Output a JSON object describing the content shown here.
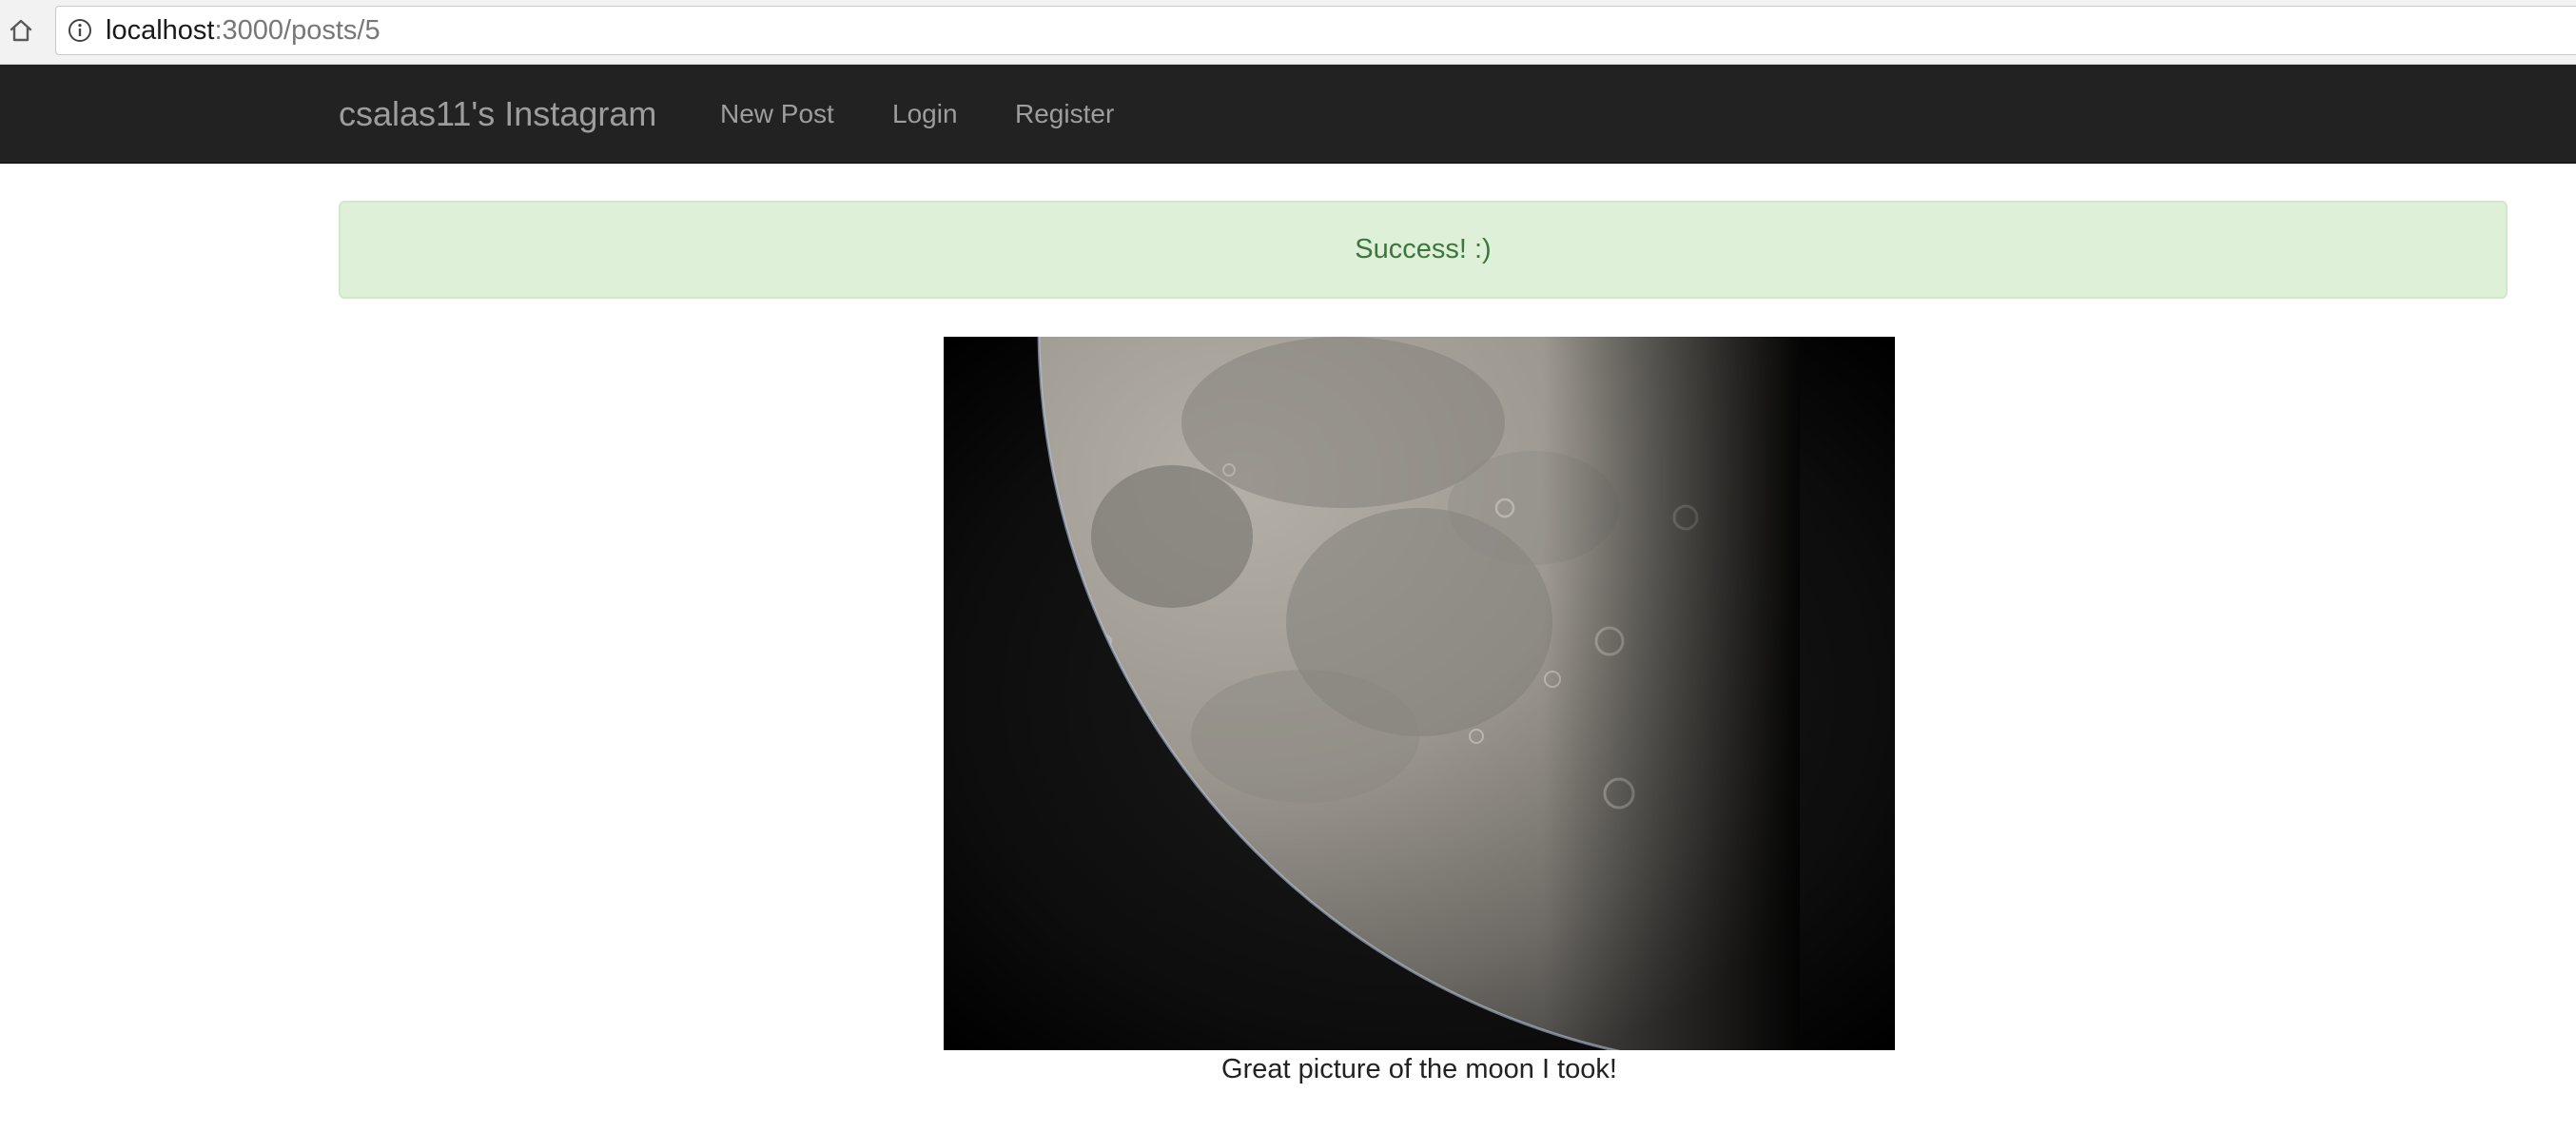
{
  "browser": {
    "url_host": "localhost",
    "url_rest": ":3000/posts/5",
    "icons": {
      "home": "home-icon",
      "info": "info-icon"
    }
  },
  "navbar": {
    "brand": "csalas11's Instagram",
    "links": [
      {
        "label": "New Post"
      },
      {
        "label": "Login"
      },
      {
        "label": "Register"
      }
    ],
    "colors": {
      "background": "#222222",
      "text": "#9d9d9d"
    }
  },
  "alert": {
    "message": "Success! :)",
    "colors": {
      "background": "#dff0d8",
      "text": "#3c763d",
      "border": "#d0e9c6"
    }
  },
  "post": {
    "image_subject": "moon photograph",
    "caption": "Great picture of the moon I took!"
  }
}
